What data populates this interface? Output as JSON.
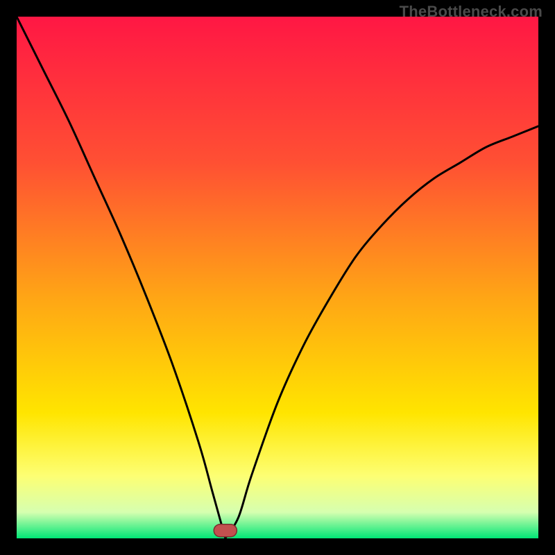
{
  "watermark": "TheBottleneck.com",
  "colors": {
    "page_bg": "#000000",
    "curve": "#000000",
    "marker_fill": "#c1504f",
    "marker_stroke": "#7a2f2f",
    "gradient_stops": [
      {
        "offset": "0%",
        "color": "#ff1744"
      },
      {
        "offset": "28%",
        "color": "#ff5033"
      },
      {
        "offset": "54%",
        "color": "#ffa615"
      },
      {
        "offset": "76%",
        "color": "#ffe500"
      },
      {
        "offset": "88%",
        "color": "#fdff73"
      },
      {
        "offset": "95%",
        "color": "#d6ffb0"
      },
      {
        "offset": "100%",
        "color": "#00e676"
      }
    ]
  },
  "chart_data": {
    "type": "line",
    "title": "",
    "xlabel": "",
    "ylabel": "",
    "xlim": [
      0,
      100
    ],
    "ylim": [
      0,
      100
    ],
    "optimum_x": 40,
    "series": [
      {
        "name": "bottleneck-curve",
        "x": [
          0,
          5,
          10,
          15,
          20,
          25,
          30,
          35,
          37.5,
          40,
          42.5,
          45,
          50,
          55,
          60,
          65,
          70,
          75,
          80,
          85,
          90,
          95,
          100
        ],
        "y": [
          100,
          90,
          80,
          69,
          58,
          46,
          33,
          18,
          9,
          0,
          4,
          12,
          26,
          37,
          46,
          54,
          60,
          65,
          69,
          72,
          75,
          77,
          79
        ]
      }
    ],
    "marker": {
      "x": 40,
      "y": 1.5,
      "rx": 2.2,
      "ry": 1.2
    }
  }
}
